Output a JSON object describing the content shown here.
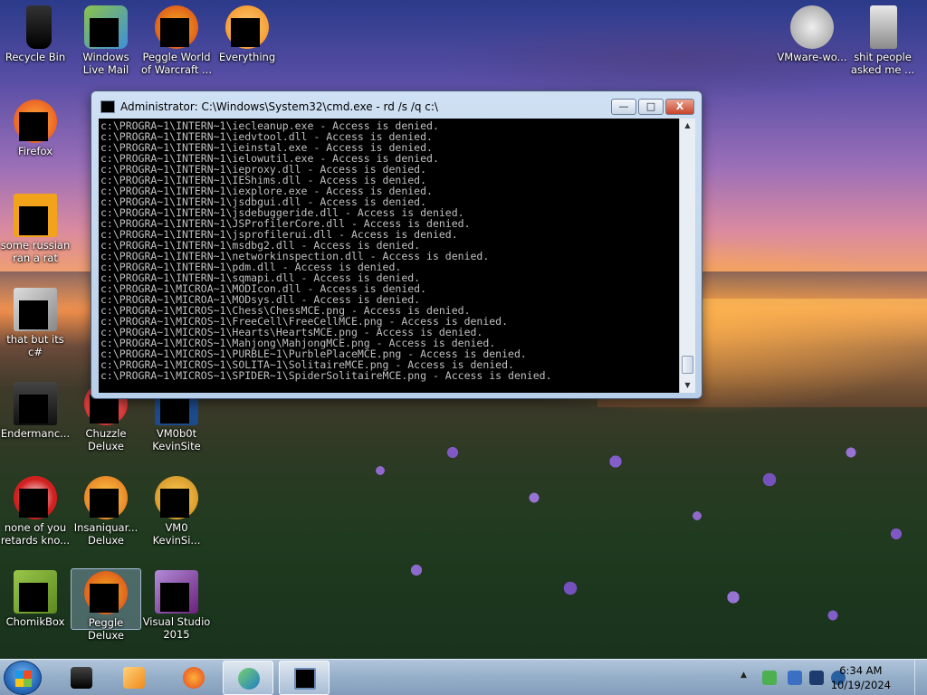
{
  "desktop": {
    "icons": [
      {
        "label": "Recycle Bin"
      },
      {
        "label": "Windows Live Mail"
      },
      {
        "label": "Peggle World of Warcraft ..."
      },
      {
        "label": "Everything"
      },
      {
        "label": "VMware-wo..."
      },
      {
        "label": "shit people asked me ..."
      },
      {
        "label": "Firefox"
      },
      {
        "label": "some russian ran a rat"
      },
      {
        "label": "that but its c#"
      },
      {
        "label": "Endermanc..."
      },
      {
        "label": "Chuzzle Deluxe"
      },
      {
        "label": "VM0b0t KevinSite"
      },
      {
        "label": "none of you retards kno..."
      },
      {
        "label": "Insaniquar... Deluxe"
      },
      {
        "label": "VM0 KevinSi..."
      },
      {
        "label": "ChomikBox"
      },
      {
        "label": "Peggle Deluxe"
      },
      {
        "label": "Visual Studio 2015"
      }
    ]
  },
  "cmd_window": {
    "title": "Administrator: C:\\Windows\\System32\\cmd.exe - rd  /s /q c:\\",
    "buttons": {
      "minimize": "—",
      "maximize": "□",
      "close": "X"
    },
    "lines": [
      "c:\\PROGRA~1\\INTERN~1\\iecleanup.exe - Access is denied.",
      "c:\\PROGRA~1\\INTERN~1\\iedvtool.dll - Access is denied.",
      "c:\\PROGRA~1\\INTERN~1\\ieinstal.exe - Access is denied.",
      "c:\\PROGRA~1\\INTERN~1\\ielowutil.exe - Access is denied.",
      "c:\\PROGRA~1\\INTERN~1\\ieproxy.dll - Access is denied.",
      "c:\\PROGRA~1\\INTERN~1\\IEShims.dll - Access is denied.",
      "c:\\PROGRA~1\\INTERN~1\\iexplore.exe - Access is denied.",
      "c:\\PROGRA~1\\INTERN~1\\jsdbgui.dll - Access is denied.",
      "c:\\PROGRA~1\\INTERN~1\\jsdebuggeride.dll - Access is denied.",
      "c:\\PROGRA~1\\INTERN~1\\JSProfilerCore.dll - Access is denied.",
      "c:\\PROGRA~1\\INTERN~1\\jsprofilerui.dll - Access is denied.",
      "c:\\PROGRA~1\\INTERN~1\\msdbg2.dll - Access is denied.",
      "c:\\PROGRA~1\\INTERN~1\\networkinspection.dll - Access is denied.",
      "c:\\PROGRA~1\\INTERN~1\\pdm.dll - Access is denied.",
      "c:\\PROGRA~1\\INTERN~1\\sqmapi.dll - Access is denied.",
      "c:\\PROGRA~1\\MICROA~1\\MODIcon.dll - Access is denied.",
      "c:\\PROGRA~1\\MICROA~1\\MODsys.dll - Access is denied.",
      "c:\\PROGRA~1\\MICROS~1\\Chess\\ChessMCE.png - Access is denied.",
      "c:\\PROGRA~1\\MICROS~1\\FreeCell\\FreeCellMCE.png - Access is denied.",
      "c:\\PROGRA~1\\MICROS~1\\Hearts\\HeartsMCE.png - Access is denied.",
      "c:\\PROGRA~1\\MICROS~1\\Mahjong\\MahjongMCE.png - Access is denied.",
      "c:\\PROGRA~1\\MICROS~1\\PURBLE~1\\PurblePlaceMCE.png - Access is denied.",
      "c:\\PROGRA~1\\MICROS~1\\SOLITA~1\\SolitaireMCE.png - Access is denied.",
      "c:\\PROGRA~1\\MICROS~1\\SPIDER~1\\SpiderSolitaireMCE.png - Access is denied."
    ]
  },
  "taskbar": {
    "items": [
      "start",
      "app-black",
      "media-player",
      "firefox",
      "download-manager",
      "cmd"
    ],
    "clock": {
      "time": "6:34 AM",
      "date": "10/19/2024"
    },
    "tray_chevron": "▲"
  },
  "colors": {
    "console_bg": "#000000",
    "console_fg": "#c0c0c0",
    "taskbar": "#a9c0dc"
  }
}
